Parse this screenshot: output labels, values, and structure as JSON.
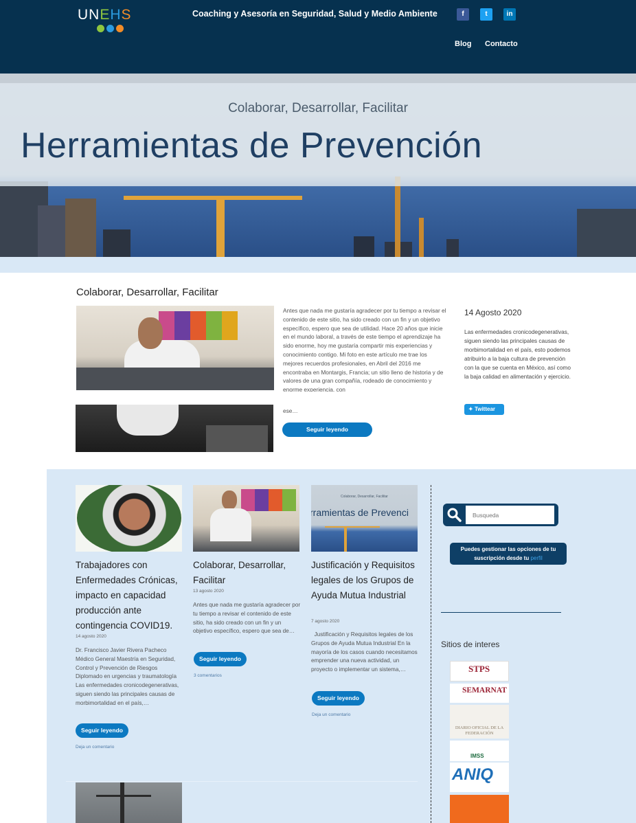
{
  "header": {
    "logo_text": "UNEHS",
    "tagline": "Coaching y Asesoría en Seguridad, Salud y Medio Ambiente",
    "social": [
      "f",
      "t",
      "in"
    ],
    "nav": [
      "Blog",
      "Contacto"
    ]
  },
  "hero": {
    "subtitle": "Colaborar, Desarrollar, Facilitar",
    "title": "Herramientas de Prevención"
  },
  "featured": {
    "title": "Colaborar, Desarrollar, Facilitar",
    "excerpt": "Antes que nada me gustaría agradecer por tu tiempo a revisar el contenido de este sitio, ha sido creado con un fin y un objetivo específico, espero que sea de utilidad. Hace 20 años que inicie en el mundo laboral, a través de este tiempo el aprendizaje ha sido enorme, hoy me gustaría compartir mis experiencias y conocimiento contigo. Mi foto en este artículo me trae los mejores recuerdos profesionales, en Abril del 2016 me encontraba en Montargis, Francia; un sitio lleno de historia y de valores de una gran compañía, rodeado de conocimiento y enorme experiencia, con",
    "excerpt_tail": "ese…",
    "read_more": "Seguir leyendo",
    "date": "14 Agosto 2020",
    "summary": "Las enfermedades cronicodegenerativas, siguen siendo las principales causas de morbimortalidad en el país, esto podemos atribuirlo a la baja cultura de prevención con la que se cuenta en México, así como la baja calidad en alimentación y ejercicio.",
    "tweet": "Twittear"
  },
  "posts": [
    {
      "title": "Trabajadores con Enfermedades Crónicas, impacto en capacidad producción ante contingencia COVID19.",
      "date": "14 agosto 2020",
      "text": "Dr. Francisco Javier Rivera Pacheco  Médico General  Maestría en Seguridad, Control y Prevención de Riesgos  Diplomado en urgencias y traumatología Las enfermedades cronicodegenerativas, siguen siendo las principales causas de morbimortalidad en el país,…",
      "read_more": "Seguir leyendo",
      "comment": "Deja un comentario"
    },
    {
      "title": "Colaborar, Desarrollar, Facilitar",
      "date": "13 agosto 2020",
      "text": "Antes que nada me gustaría agradecer por tu tiempo a revisar el contenido de este sitio, ha sido creado con un fin y un objetivo específico, espero que sea de…",
      "read_more": "Seguir leyendo",
      "comment": "3 comentarios"
    },
    {
      "title": "Justificación y Requisitos legales de los Grupos de Ayuda Mutua Industrial",
      "date": "7 agosto 2020",
      "text": "  Justificación y Requisitos legales de los Grupos de Ayuda Mutua Industrial En la mayoría de los casos cuando necesitamos emprender una nueva actividad, un proyecto o implementar un sistema,…",
      "read_more": "Seguir leyendo",
      "comment": "Deja un comentario",
      "img_sub": "Colaborar, Desarrollar, Facilitar",
      "img_title": "rramientas de Prevenci"
    }
  ],
  "sidebar": {
    "search_placeholder": "Busqueda",
    "subscription_text": "Puedes gestionar las opciones de tu suscripción desde tu",
    "subscription_link": "perfil",
    "sites_heading": "Sitios de interes",
    "sites": [
      "STPS",
      "SEMARNAT",
      "DIARIO OFICIAL DE LA FEDERACIÓN",
      "IMSS",
      "ANIQ",
      ""
    ]
  },
  "colors": {
    "header_bg": "#06314f",
    "accent_button": "#0c79c1",
    "section_bg": "#d9e8f6"
  }
}
